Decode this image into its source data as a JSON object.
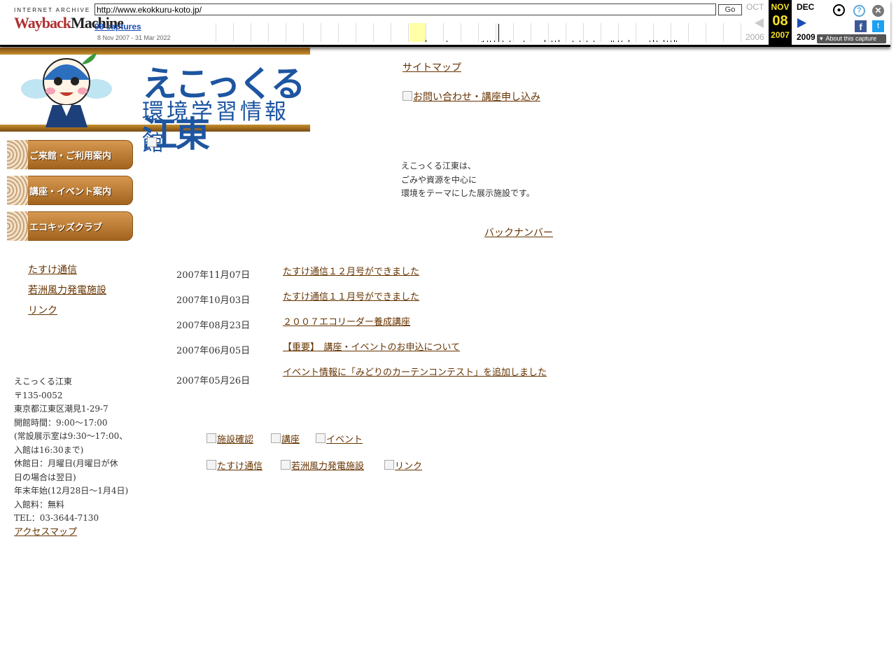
{
  "wayback": {
    "logo_top": "INTERNET ARCHIVE",
    "logo_a": "Wayback",
    "logo_b": "Machine",
    "url": "http://www.ekokkuru-koto.jp/",
    "go_label": "Go",
    "captures": "98 captures",
    "range": "8 Nov 2007 - 31 Mar 2022",
    "prev_month": "OCT",
    "prev_year": "2006",
    "cur_month": "NOV",
    "cur_day": "08",
    "cur_year": "2007",
    "next_month": "DEC",
    "next_year": "2009",
    "about": "About this capture"
  },
  "header": {
    "title": "えこっくる江東",
    "subtitle": "環境学習情報館",
    "sitemap": "サイトマップ",
    "contact": "お問い合わせ・講座申し込み"
  },
  "nav": [
    {
      "label": "ご来館・ご利用案内"
    },
    {
      "label": "講座・イベント案内"
    },
    {
      "label": "エコキッズクラブ"
    }
  ],
  "sidelinks": [
    {
      "label": "たすけ通信"
    },
    {
      "label": "若洲風力発電施設"
    },
    {
      "label": "リンク"
    }
  ],
  "info": {
    "name": "えこっくる江東",
    "zip": "〒135-0052",
    "address": "東京都江東区潮見1-29-7",
    "hours": "開館時間：9:00～17:00",
    "hours2": "(常設展示室は9:30～17:00、",
    "hours3": "入館は16:30まで)",
    "closed": "休館日：月曜日(月曜日が休",
    "closed2": "日の場合は翌日)",
    "closed3": "年末年始(12月28日～1月4日)",
    "fee": "入館料：無料",
    "tel": "TEL：03-3644-7130",
    "access": "アクセスマップ"
  },
  "intro": {
    "line1": "えこっくる江東は、",
    "line2": "ごみや資源を中心に",
    "line3": "環境をテーマにした展示施設です。"
  },
  "backnumber": "バックナンバー",
  "news": [
    {
      "date": "2007年11月07日",
      "title": "たすけ通信１２月号ができました"
    },
    {
      "date": "2007年10月03日",
      "title": "たすけ通信１１月号ができました"
    },
    {
      "date": "2007年08月23日",
      "title": "２００７エコリーダー養成講座"
    },
    {
      "date": "2007年06月05日",
      "title": "【重要】　講座・イベントのお申込について"
    },
    {
      "date": "2007年05月26日",
      "title": "イベント情報に「みどりのカーテンコンテスト」を追加しました"
    }
  ],
  "footer": {
    "row1": [
      "施設確認",
      "講座",
      "イベント"
    ],
    "row2": [
      "たすけ通信",
      "若洲風力発電施設",
      "リンク"
    ]
  }
}
